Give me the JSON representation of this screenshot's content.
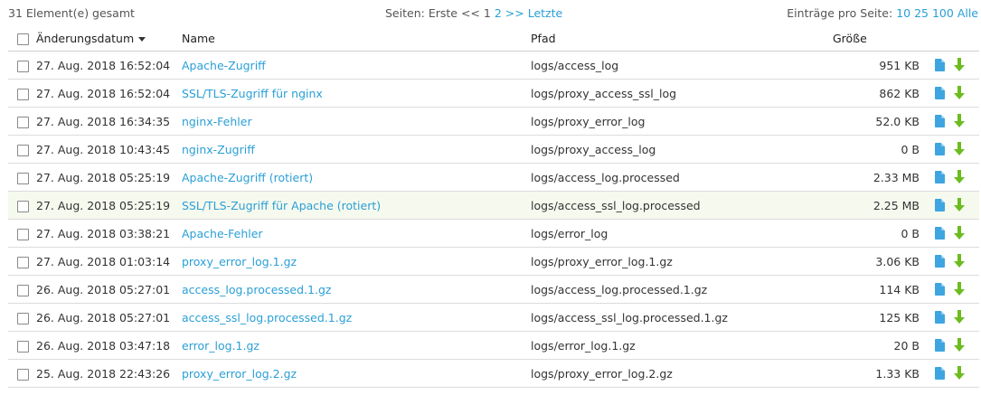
{
  "summary": {
    "total": "31 Element(e) gesamt"
  },
  "pager": {
    "prefix": "Seiten:",
    "first": "Erste",
    "prev": "<<",
    "current": "1",
    "next_page": "2",
    "next": ">>",
    "last": "Letzte"
  },
  "per_page": {
    "label": "Einträge pro Seite:",
    "options": [
      "10",
      "25",
      "100",
      "Alle"
    ]
  },
  "columns": {
    "date": "Änderungsdatum",
    "name": "Name",
    "path": "Pfad",
    "size": "Größe"
  },
  "rows": [
    {
      "date": "27. Aug. 2018 16:52:04",
      "name": "Apache-Zugriff",
      "path": "logs/access_log",
      "size": "951 KB"
    },
    {
      "date": "27. Aug. 2018 16:52:04",
      "name": "SSL/TLS-Zugriff für nginx",
      "path": "logs/proxy_access_ssl_log",
      "size": "862 KB"
    },
    {
      "date": "27. Aug. 2018 16:34:35",
      "name": "nginx-Fehler",
      "path": "logs/proxy_error_log",
      "size": "52.0 KB"
    },
    {
      "date": "27. Aug. 2018 10:43:45",
      "name": "nginx-Zugriff",
      "path": "logs/proxy_access_log",
      "size": "0 B"
    },
    {
      "date": "27. Aug. 2018 05:25:19",
      "name": "Apache-Zugriff (rotiert)",
      "path": "logs/access_log.processed",
      "size": "2.33 MB"
    },
    {
      "date": "27. Aug. 2018 05:25:19",
      "name": "SSL/TLS-Zugriff für Apache (rotiert)",
      "path": "logs/access_ssl_log.processed",
      "size": "2.25 MB"
    },
    {
      "date": "27. Aug. 2018 03:38:21",
      "name": "Apache-Fehler",
      "path": "logs/error_log",
      "size": "0 B"
    },
    {
      "date": "27. Aug. 2018 01:03:14",
      "name": "proxy_error_log.1.gz",
      "path": "logs/proxy_error_log.1.gz",
      "size": "3.06 KB"
    },
    {
      "date": "26. Aug. 2018 05:27:01",
      "name": "access_log.processed.1.gz",
      "path": "logs/access_log.processed.1.gz",
      "size": "114 KB"
    },
    {
      "date": "26. Aug. 2018 05:27:01",
      "name": "access_ssl_log.processed.1.gz",
      "path": "logs/access_ssl_log.processed.1.gz",
      "size": "125 KB"
    },
    {
      "date": "26. Aug. 2018 03:47:18",
      "name": "error_log.1.gz",
      "path": "logs/error_log.1.gz",
      "size": "20 B"
    },
    {
      "date": "25. Aug. 2018 22:43:26",
      "name": "proxy_error_log.2.gz",
      "path": "logs/proxy_error_log.2.gz",
      "size": "1.33 KB"
    }
  ],
  "icons": {
    "row_view": "file-icon",
    "row_download": "download-arrow-icon"
  },
  "colors": {
    "link": "#2a9fd6",
    "download": "#6cbc1f",
    "file_icon": "#3ea5e0",
    "highlight_row": "#f6f9ee"
  }
}
